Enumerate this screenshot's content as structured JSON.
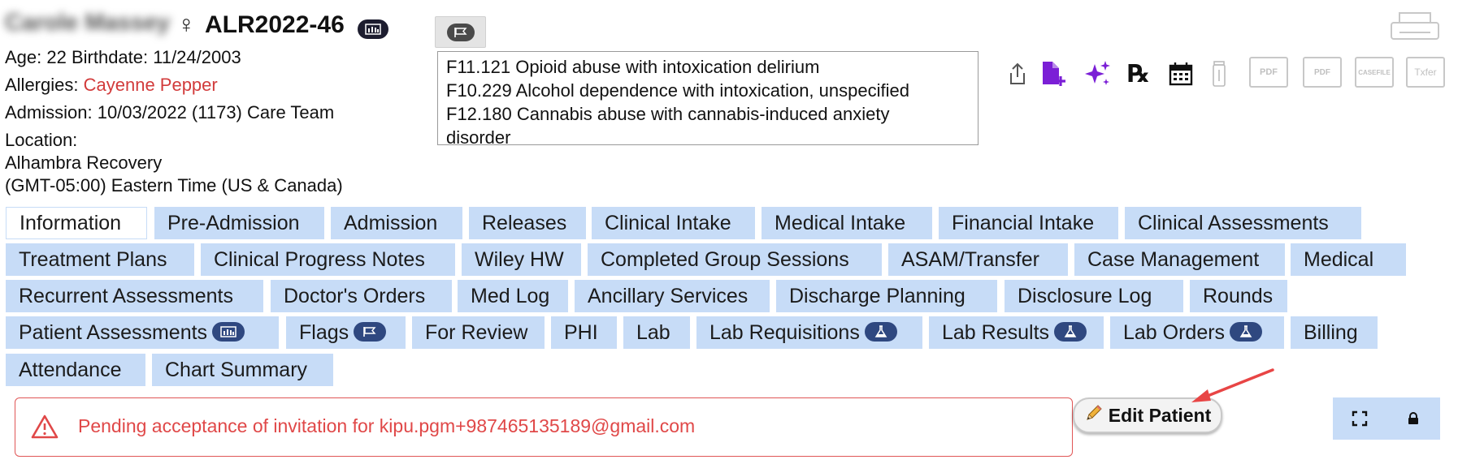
{
  "patient": {
    "name": "Carole Massey",
    "gender_symbol": "♀",
    "id": "ALR2022-46",
    "age_line": "Age: 22   Birthdate: 11/24/2003",
    "allergies_label": "Allergies:",
    "allergies_value": "Cayenne Pepper",
    "admission_line": "Admission: 10/03/2022 (1173)  Care Team",
    "location_label": "Location:",
    "location_value": "Alhambra Recovery",
    "timezone": "(GMT-05:00) Eastern Time (US & Canada)"
  },
  "diagnoses": [
    "F11.121 Opioid abuse with intoxication delirium",
    "F10.229 Alcohol dependence with intoxication, unspecified",
    "F12.180 Cannabis abuse with cannabis-induced anxiety",
    "disorder"
  ],
  "toolbar": {
    "icons": [
      "share-icon",
      "add-document-icon",
      "sparkle-icon",
      "prescription-icon",
      "calendar-icon",
      "bottle-icon",
      "pdf-icon",
      "pdf-stack-icon",
      "casefile-icon",
      "transfer-icon",
      "printer-icon"
    ],
    "rx_glyph": "℞",
    "pdf_label": "PDF",
    "pdf_stack_label": "PDF",
    "casefile_label": "CASEFILE",
    "transfer_label": "Txfer"
  },
  "tabs": {
    "row1": [
      "Information",
      "Pre-Admission",
      "Admission",
      "Releases",
      "Clinical Intake",
      "Medical Intake",
      "Financial Intake",
      "Clinical Assessments"
    ],
    "row2": [
      "Treatment Plans",
      "Clinical Progress Notes",
      "Wiley HW",
      "Completed Group Sessions",
      "ASAM/Transfer",
      "Case Management",
      "Medical"
    ],
    "row3": [
      "Recurrent Assessments",
      "Doctor's Orders",
      "Med Log",
      "Ancillary Services",
      "Discharge Planning",
      "Disclosure Log",
      "Rounds"
    ],
    "row4": [
      "Patient Assessments",
      "Flags",
      "For Review",
      "PHI",
      "Lab",
      "Lab Requisitions",
      "Lab Results",
      "Lab Orders",
      "Billing"
    ],
    "row5": [
      "Attendance",
      "Chart Summary"
    ],
    "active": "Information"
  },
  "alert": {
    "message": "Pending acceptance of invitation for kipu.pgm+987465135189@gmail.com"
  },
  "edit_patient": {
    "label": "Edit Patient"
  },
  "colors": {
    "tab_bg": "#c7dcf7",
    "badge_bg": "#2f4880",
    "allergy_red": "#d23b3b",
    "alert_red": "#e04848",
    "icon_purple": "#7b1fd6"
  }
}
